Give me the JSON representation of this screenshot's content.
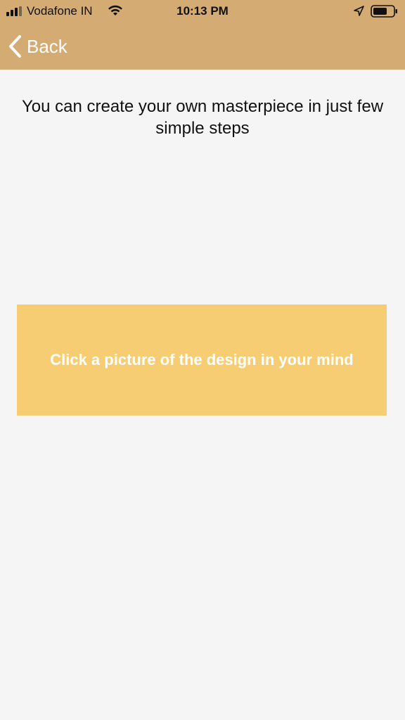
{
  "status_bar": {
    "carrier": "Vodafone IN",
    "time": "10:13 PM",
    "icons": [
      "signal-icon",
      "wifi-icon",
      "location-arrow-icon",
      "battery-icon"
    ]
  },
  "navigation": {
    "back_label": "Back",
    "back_icon": "chevron-left-icon"
  },
  "main": {
    "headline": "You can create your own masterpiece in just few simple steps",
    "action_label": "Click a picture of the design in your mind"
  },
  "colors": {
    "header_background": "#d4ab72",
    "page_background": "#f5f5f5",
    "action_card_background": "#f7cd74",
    "action_text": "#ffffff"
  }
}
